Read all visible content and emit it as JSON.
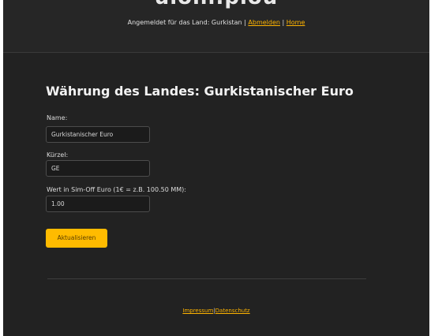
{
  "header": {
    "logo_text": "ulonl.plou",
    "login_text": "Angemeldet für das Land: Gurkistan |",
    "logout_label": "Abmelden",
    "separator": "|",
    "home_label": "Home"
  },
  "page": {
    "title": "Währung des Landes: Gurkistanischer Euro"
  },
  "form": {
    "name_label": "Name:",
    "name_value": "Gurkistanischer Euro",
    "short_label": "Kürzel:",
    "short_value": "GE",
    "value_label": "Wert in Sim-Off Euro (1€ = z.B. 100.50 MM):",
    "value_value": "1.00",
    "submit_label": "Aktualisieren"
  },
  "footer": {
    "impressum_label": "Impressum",
    "separator": "|",
    "datenschutz_label": "Datenschutz"
  },
  "colors": {
    "accent": "#ffbb00",
    "background": "#222222"
  }
}
